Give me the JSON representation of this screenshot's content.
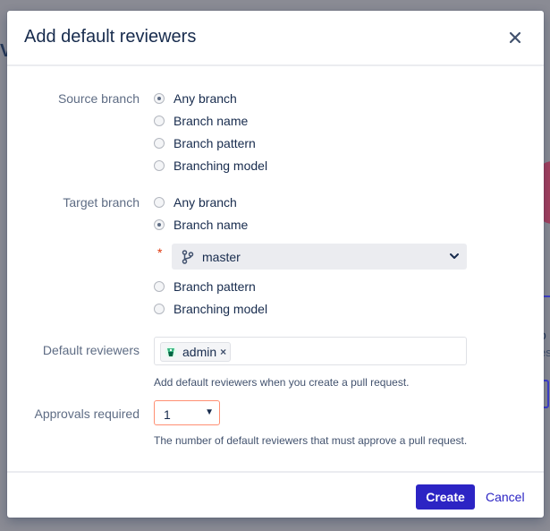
{
  "background": {
    "partial_letter": "V",
    "partial_text_1": "o",
    "partial_text_2": "es"
  },
  "dialog": {
    "title": "Add default reviewers",
    "close_icon": "close-icon"
  },
  "source_branch": {
    "label": "Source branch",
    "options": [
      "Any branch",
      "Branch name",
      "Branch pattern",
      "Branching model"
    ],
    "selected": "Any branch"
  },
  "target_branch": {
    "label": "Target branch",
    "options": [
      "Any branch",
      "Branch name",
      "Branch pattern",
      "Branching model"
    ],
    "selected": "Branch name",
    "branch_value": "master",
    "branch_icon": "git-branch-icon",
    "required_mark": "*"
  },
  "default_reviewers": {
    "label": "Default reviewers",
    "tags": [
      {
        "name": "admin",
        "avatar_icon": "avatar-icon"
      }
    ],
    "remove_symbol": "×",
    "help": "Add default reviewers when you create a pull request."
  },
  "approvals": {
    "label": "Approvals required",
    "value": "1",
    "help": "The number of default reviewers that must approve a pull request."
  },
  "footer": {
    "create_label": "Create",
    "cancel_label": "Cancel"
  },
  "colors": {
    "primary": "#2c24c4",
    "required": "#de350b",
    "focus_border": "#ff8f73"
  }
}
